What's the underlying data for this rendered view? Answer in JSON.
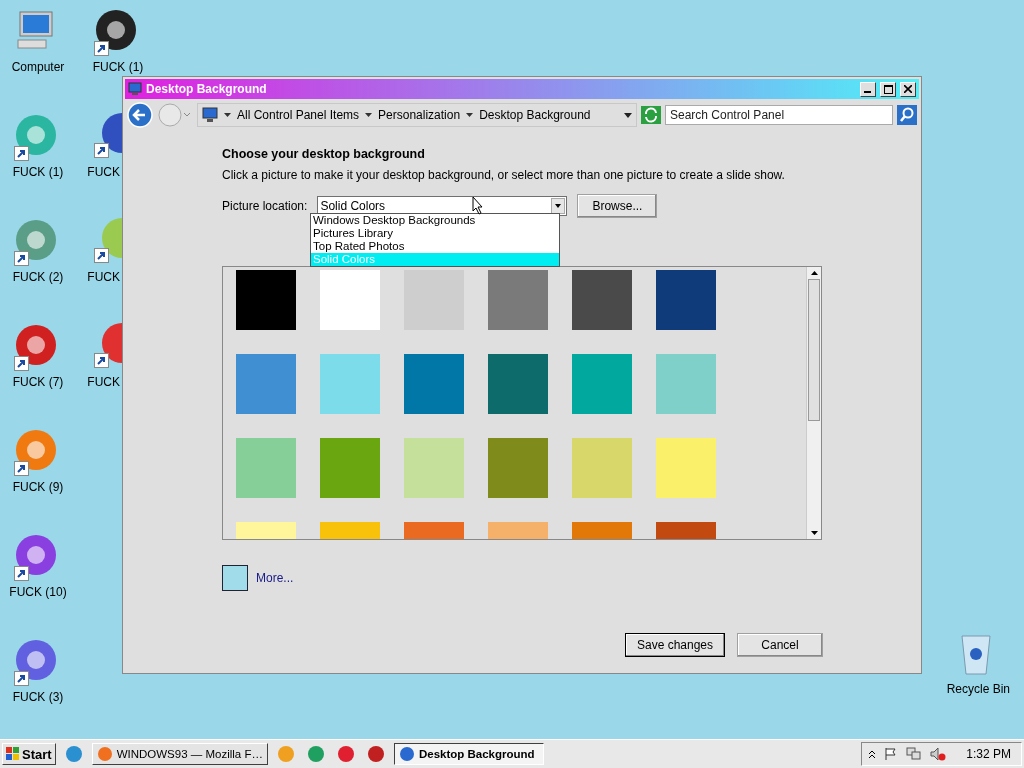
{
  "desktop": {
    "columns": [
      [
        {
          "label": "Computer",
          "shortcut": false
        },
        {
          "label": "FUCK (1)",
          "shortcut": true
        },
        {
          "label": "FUCK (2)",
          "shortcut": true
        },
        {
          "label": "FUCK (7)",
          "shortcut": true
        },
        {
          "label": "FUCK (9)",
          "shortcut": true
        },
        {
          "label": "FUCK (10)",
          "shortcut": true
        },
        {
          "label": "FUCK (3)",
          "shortcut": true
        }
      ],
      [
        {
          "label": "FUCK (1)",
          "shortcut": true
        },
        {
          "label": "FUCK",
          "shortcut": true
        },
        {
          "label": "FUCK",
          "shortcut": true
        },
        {
          "label": "FUCK",
          "shortcut": true
        }
      ]
    ],
    "recycle_bin": {
      "label": "Recycle Bin",
      "shortcut": false
    }
  },
  "window": {
    "title": "Desktop Background",
    "breadcrumb": [
      "All Control Panel Items",
      "Personalization",
      "Desktop Background"
    ],
    "search": {
      "placeholder": "Search Control Panel"
    },
    "heading": "Choose your desktop background",
    "description": "Click a picture to make it your desktop background, or select more than one picture to create a slide show.",
    "location": {
      "label": "Picture location:",
      "value": "Solid Colors",
      "expanded": true,
      "options": [
        {
          "label": "Windows Desktop Backgrounds",
          "selected": false
        },
        {
          "label": "Pictures Library",
          "selected": false
        },
        {
          "label": "Top Rated Photos",
          "selected": false
        },
        {
          "label": "Solid Colors",
          "selected": true
        }
      ]
    },
    "browse_button": "Browse...",
    "swatches": [
      [
        {
          "color": "#000000"
        },
        {
          "color": "#ffffff"
        },
        {
          "color": "#cecece"
        },
        {
          "color": "#7a7a7a"
        },
        {
          "color": "#4a4a4a"
        },
        {
          "color": "#0f3b7a"
        }
      ],
      [
        {
          "color": "#3f8fd2"
        },
        {
          "color": "#7ddcea"
        },
        {
          "color": "#0077a6"
        },
        {
          "color": "#0e6b6b"
        },
        {
          "color": "#00a89d"
        },
        {
          "color": "#7fd0c8"
        }
      ],
      [
        {
          "color": "#86cf99"
        },
        {
          "color": "#6aa60f"
        },
        {
          "color": "#c4e09b"
        },
        {
          "color": "#7f8c1c"
        },
        {
          "color": "#d8d86a"
        },
        {
          "color": "#fbf06a"
        }
      ],
      [
        {
          "color": "#fff59a"
        },
        {
          "color": "#f8c20b"
        },
        {
          "color": "#ea6a22"
        },
        {
          "color": "#f5b06a"
        },
        {
          "color": "#e27808"
        },
        {
          "color": "#c24a10"
        }
      ]
    ],
    "more": {
      "label": "More...",
      "color": "#a0dcea"
    },
    "buttons": [
      "Save changes",
      "Cancel"
    ]
  },
  "taskbar": {
    "start": "Start",
    "items": [
      {
        "kind": "icon"
      },
      {
        "kind": "task",
        "label": "WINDOWS93 — Mozilla F…",
        "selected": false
      },
      {
        "kind": "icon"
      },
      {
        "kind": "icon"
      },
      {
        "kind": "icon"
      },
      {
        "kind": "icon"
      },
      {
        "kind": "task",
        "label": "Desktop Background",
        "selected": true
      }
    ],
    "clock": "1:32 PM"
  }
}
